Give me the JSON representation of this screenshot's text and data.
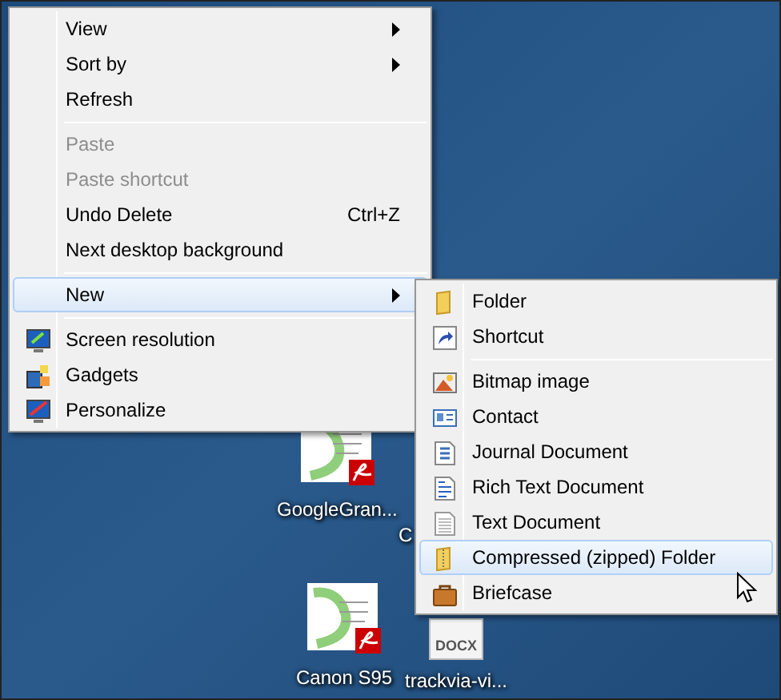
{
  "desktop_icons": [
    {
      "label": "GoogleGran...",
      "kind": "pdf"
    },
    {
      "label": "C",
      "kind": "hidden"
    },
    {
      "label": "Canon S95",
      "kind": "pdf"
    },
    {
      "label": "trackvia-vi...",
      "kind": "docx",
      "badge": "DOCX"
    }
  ],
  "context_menu": {
    "items": [
      {
        "kind": "item",
        "label": "View",
        "submenu": true,
        "disabled": false,
        "selected": false
      },
      {
        "kind": "item",
        "label": "Sort by",
        "submenu": true,
        "disabled": false,
        "selected": false
      },
      {
        "kind": "item",
        "label": "Refresh",
        "submenu": false,
        "disabled": false,
        "selected": false
      },
      {
        "kind": "separator"
      },
      {
        "kind": "item",
        "label": "Paste",
        "submenu": false,
        "disabled": true,
        "selected": false
      },
      {
        "kind": "item",
        "label": "Paste shortcut",
        "submenu": false,
        "disabled": true,
        "selected": false
      },
      {
        "kind": "item",
        "label": "Undo Delete",
        "shortcut": "Ctrl+Z",
        "submenu": false,
        "disabled": false,
        "selected": false
      },
      {
        "kind": "item",
        "label": "Next desktop background",
        "submenu": false,
        "disabled": false,
        "selected": false
      },
      {
        "kind": "separator"
      },
      {
        "kind": "item",
        "label": "New",
        "submenu": true,
        "disabled": false,
        "selected": true
      },
      {
        "kind": "separator"
      },
      {
        "kind": "item",
        "label": "Screen resolution",
        "submenu": false,
        "disabled": false,
        "selected": false
      },
      {
        "kind": "item",
        "label": "Gadgets",
        "submenu": false,
        "disabled": false,
        "selected": false
      },
      {
        "kind": "item",
        "label": "Personalize",
        "submenu": false,
        "disabled": false,
        "selected": false
      }
    ]
  },
  "new_submenu": {
    "items": [
      {
        "kind": "item",
        "label": "Folder",
        "selected": false
      },
      {
        "kind": "item",
        "label": "Shortcut",
        "selected": false
      },
      {
        "kind": "separator"
      },
      {
        "kind": "item",
        "label": "Bitmap image",
        "selected": false
      },
      {
        "kind": "item",
        "label": "Contact",
        "selected": false
      },
      {
        "kind": "item",
        "label": "Journal Document",
        "selected": false
      },
      {
        "kind": "item",
        "label": "Rich Text Document",
        "selected": false
      },
      {
        "kind": "item",
        "label": "Text Document",
        "selected": false
      },
      {
        "kind": "item",
        "label": "Compressed (zipped) Folder",
        "selected": true
      },
      {
        "kind": "item",
        "label": "Briefcase",
        "selected": false
      }
    ]
  }
}
